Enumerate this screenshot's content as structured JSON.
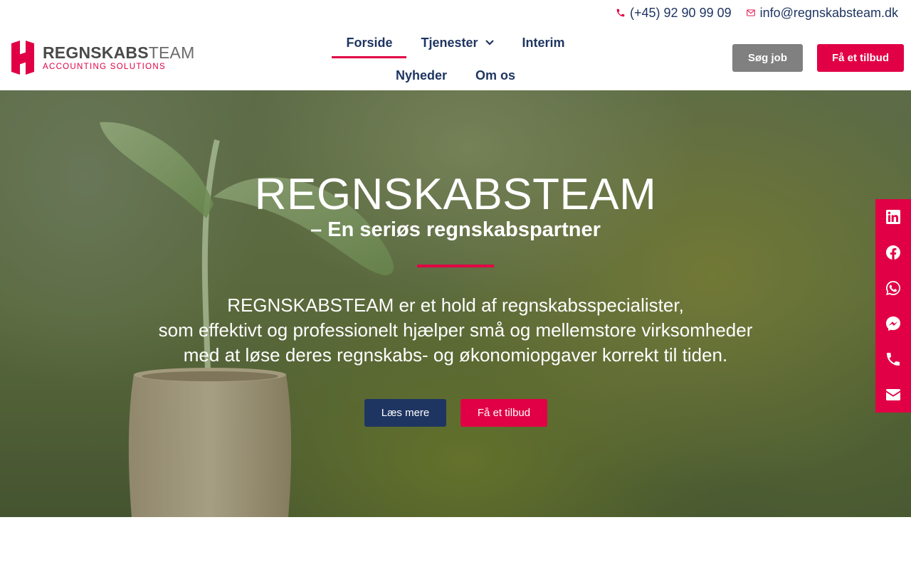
{
  "topbar": {
    "phone": "(+45) 92 90 99 09",
    "email": "info@regnskabsteam.dk"
  },
  "logo": {
    "title_bold": "REGNSKABS",
    "title_light": "TEAM",
    "subtitle": "ACCOUNTING SOLUTIONS"
  },
  "nav": {
    "items": [
      {
        "label": "Forside",
        "active": true
      },
      {
        "label": "Tjenester",
        "dropdown": true
      },
      {
        "label": "Interim"
      },
      {
        "label": "Nyheder"
      },
      {
        "label": "Om os"
      }
    ]
  },
  "header_buttons": {
    "job_label": "Søg job",
    "offer_label": "Få et tilbud"
  },
  "hero": {
    "title": "REGNSKABSTEAM",
    "subtitle": "– En seriøs regnskabspartner",
    "lines": [
      "REGNSKABSTEAM er et hold af regnskabsspecialister,",
      "som effektivt og professionelt hjælper små og mellemstore virksomheder",
      "med at løse deres regnskabs- og økonomiopgaver korrekt til tiden."
    ],
    "read_more_label": "Læs mere",
    "offer_label": "Få et tilbud"
  },
  "social": {
    "icons": [
      "linkedin-icon",
      "facebook-icon",
      "whatsapp-icon",
      "messenger-icon",
      "phone-icon",
      "email-icon"
    ]
  },
  "colors": {
    "brand_red": "#e10045",
    "navy": "#1f3561",
    "gray_button": "#808080"
  }
}
